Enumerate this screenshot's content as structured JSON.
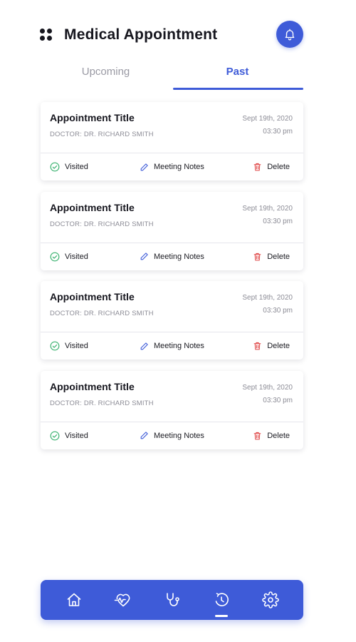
{
  "header": {
    "title": "Medical Appointment",
    "menu_icon": "grid-dots-icon",
    "notification_icon": "bell-icon"
  },
  "tabs": [
    {
      "label": "Upcoming",
      "active": false
    },
    {
      "label": "Past",
      "active": true
    }
  ],
  "appointments": [
    {
      "title": "Appointment Title",
      "doctor": "DOCTOR: DR. RICHARD SMITH",
      "date": "Sept 19th, 2020",
      "time": "03:30 pm",
      "status_label": "Visited",
      "notes_label": "Meeting Notes",
      "delete_label": "Delete"
    },
    {
      "title": "Appointment Title",
      "doctor": "DOCTOR: DR. RICHARD SMITH",
      "date": "Sept 19th, 2020",
      "time": "03:30 pm",
      "status_label": "Visited",
      "notes_label": "Meeting Notes",
      "delete_label": "Delete"
    },
    {
      "title": "Appointment Title",
      "doctor": "DOCTOR: DR. RICHARD SMITH",
      "date": "Sept 19th, 2020",
      "time": "03:30 pm",
      "status_label": "Visited",
      "notes_label": "Meeting Notes",
      "delete_label": "Delete"
    },
    {
      "title": "Appointment Title",
      "doctor": "DOCTOR: DR. RICHARD SMITH",
      "date": "Sept 19th, 2020",
      "time": "03:30 pm",
      "status_label": "Visited",
      "notes_label": "Meeting Notes",
      "delete_label": "Delete"
    }
  ],
  "bottom_nav": [
    {
      "icon": "home-icon",
      "active": false
    },
    {
      "icon": "heartbeat-icon",
      "active": false
    },
    {
      "icon": "stethoscope-icon",
      "active": false
    },
    {
      "icon": "history-icon",
      "active": true
    },
    {
      "icon": "gear-icon",
      "active": false
    }
  ],
  "colors": {
    "accent": "#3e5bd8",
    "visited": "#3cb371",
    "delete": "#e04848",
    "muted_text": "#8c8c96"
  }
}
